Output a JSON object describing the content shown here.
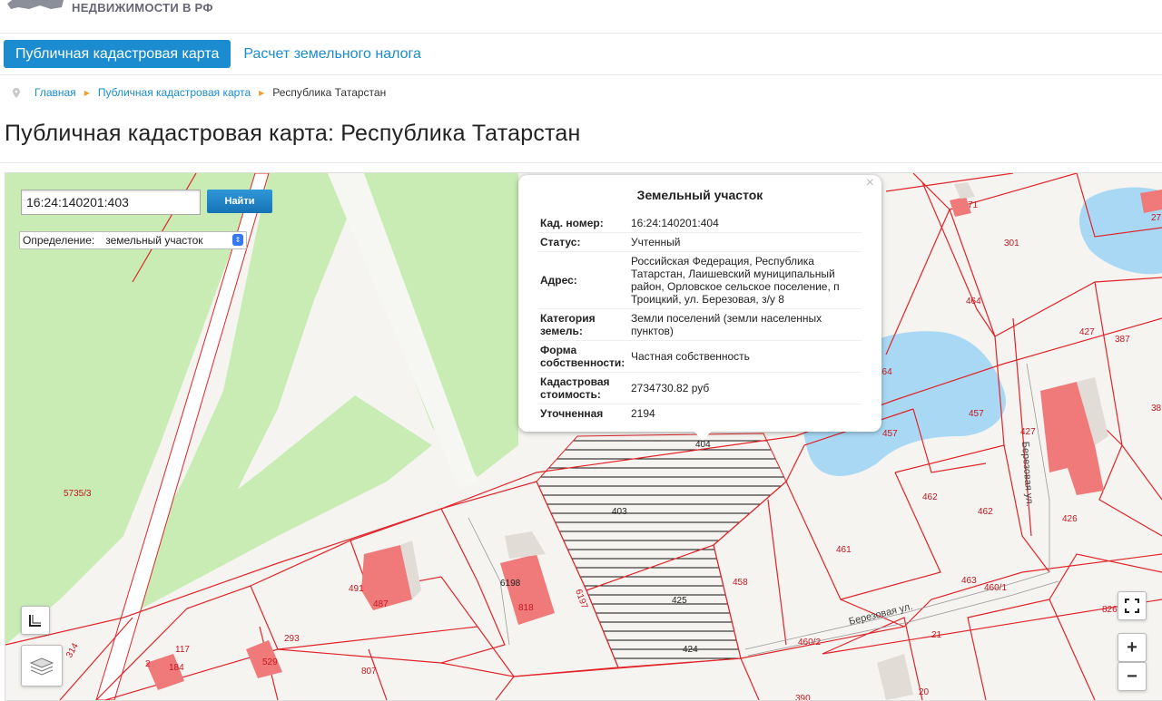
{
  "header": {
    "logo_text": "НЕДВИЖИМОСТИ В РФ"
  },
  "nav": {
    "tabs": [
      "Публичная кадастровая карта",
      "Расчет земельного налога"
    ]
  },
  "breadcrumb": {
    "items": [
      "Главная",
      "Публичная кадастровая карта",
      "Республика Татарстан"
    ]
  },
  "page_title": "Публичная кадастровая карта: Республика Татарстан",
  "search": {
    "value": "16:24:140201:403",
    "button_label": "Найти"
  },
  "definition": {
    "label": "Определение:",
    "value": "земельный участок"
  },
  "popup": {
    "title": "Земельный участок",
    "rows": [
      {
        "key": "Кад. номер:",
        "value": "16:24:140201:404"
      },
      {
        "key": "Статус:",
        "value": "Учтенный"
      },
      {
        "key": "Адрес:",
        "value": "Российская Федерация, Республика Татарстан, Лаишевский муниципальный район, Орловское сельское поселение, п Троицкий, ул. Березовая, з/у 8"
      },
      {
        "key": "Категория земель:",
        "value": "Земли поселений (земли населенных пунктов)"
      },
      {
        "key": "Форма собственности:",
        "value": "Частная собственность"
      },
      {
        "key": "Кадастровая стоимость:",
        "value": "2734730.82 руб"
      },
      {
        "key": "Уточненная",
        "value": "2194"
      }
    ]
  },
  "map": {
    "parcel_labels": [
      "5735/3",
      "404",
      "403",
      "425",
      "424",
      "458",
      "461",
      "462",
      "462",
      "457",
      "457",
      "464",
      "464",
      "427",
      "387",
      "301",
      "427",
      "426",
      "463",
      "460/1",
      "460/2",
      "21",
      "20",
      "826",
      "491",
      "487",
      "6198",
      "818",
      "6197",
      "293",
      "529",
      "117",
      "184",
      "2",
      "314",
      "807",
      "71",
      "27",
      "38",
      "390"
    ],
    "street_labels": [
      "Березовая ул.",
      "Березовая ул."
    ]
  },
  "colors": {
    "accent": "#1a8ccf",
    "parcel_line": "#e0242a",
    "building": "#f07a7a",
    "park": "#c8ecb4",
    "water": "#a8d8f4"
  }
}
